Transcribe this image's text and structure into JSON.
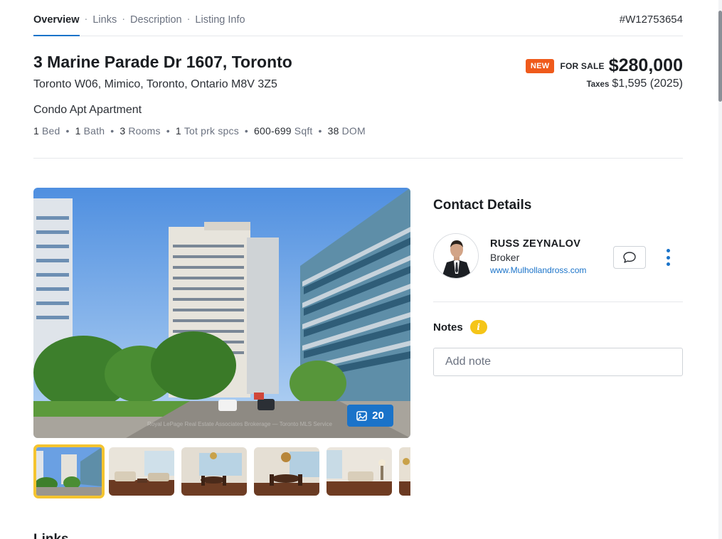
{
  "tabs": [
    {
      "label": "Overview"
    },
    {
      "label": "Links"
    },
    {
      "label": "Description"
    },
    {
      "label": "Listing Info"
    }
  ],
  "tab_separator": "·",
  "listing_id": "#W12753654",
  "listing": {
    "title": "3 Marine Parade Dr 1607, Toronto",
    "address": "Toronto W06, Mimico, Toronto, Ontario M8V 3Z5",
    "property_type": "Condo Apt Apartment",
    "specs": [
      {
        "value": "1",
        "label": "Bed"
      },
      {
        "value": "1",
        "label": "Bath"
      },
      {
        "value": "3",
        "label": "Rooms"
      },
      {
        "value": "1",
        "label": "Tot prk spcs"
      },
      {
        "value": "600-699",
        "label": "Sqft"
      },
      {
        "value": "38",
        "label": "DOM"
      }
    ],
    "spec_separator": "•",
    "badge": "NEW",
    "status": "FOR SALE",
    "price": "$280,000",
    "taxes_label": "Taxes",
    "taxes_value": "$1,595 (2025)"
  },
  "gallery": {
    "photo_count": "20",
    "watermark": "Royal LePage Real Estate Associates Brokerage — Toronto MLS Service",
    "thumbnails": [
      {
        "icon": "exterior-photo",
        "selected": true
      },
      {
        "icon": "living-room-photo",
        "selected": false
      },
      {
        "icon": "dining-room-photo",
        "selected": false
      },
      {
        "icon": "dining-chandelier-photo",
        "selected": false
      },
      {
        "icon": "living-room-photo",
        "selected": false
      },
      {
        "icon": "room-photo",
        "selected": false
      }
    ]
  },
  "contact": {
    "heading": "Contact Details",
    "agent_name": "RUSS ZEYNALOV",
    "agent_role": "Broker",
    "agent_website": "www.Mulhollandross.com"
  },
  "notes": {
    "label": "Notes",
    "info_glyph": "i",
    "placeholder": "Add note"
  },
  "next_section_heading": "Links",
  "colors": {
    "accent": "#1a73c9",
    "badge_new": "#ef5a1b",
    "selected_thumb_border": "#f4c430",
    "info_icon": "#f5c518"
  }
}
